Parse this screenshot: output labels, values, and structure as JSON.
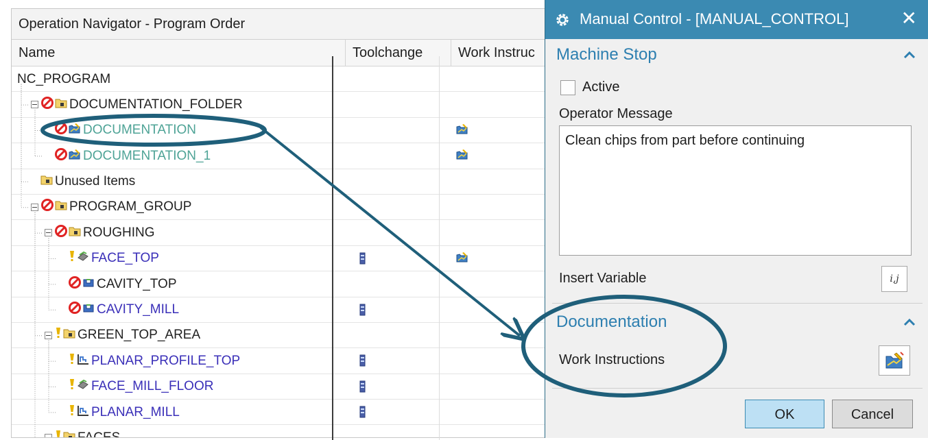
{
  "navigator": {
    "title": "Operation Navigator - Program Order",
    "columns": [
      "Name",
      "Toolchange",
      "Work Instruc"
    ],
    "rows": [
      {
        "name": "NC_PROGRAM",
        "color": "dark",
        "indent": 0,
        "toggle": false,
        "status": "none",
        "icon": "none",
        "tool": false,
        "work": false
      },
      {
        "name": "DOCUMENTATION_FOLDER",
        "color": "dark",
        "indent": 1,
        "toggle": true,
        "status": "prohibited",
        "icon": "folder",
        "tool": false,
        "work": false
      },
      {
        "name": "DOCUMENTATION",
        "color": "teal",
        "indent": 2,
        "toggle": false,
        "status": "prohibited",
        "icon": "doc",
        "tool": false,
        "work": true
      },
      {
        "name": "DOCUMENTATION_1",
        "color": "teal",
        "indent": 2,
        "toggle": false,
        "status": "prohibited",
        "icon": "doc",
        "tool": false,
        "work": true
      },
      {
        "name": "Unused Items",
        "color": "dark",
        "indent": 1,
        "toggle": false,
        "status": "none",
        "icon": "folder",
        "tool": false,
        "work": false
      },
      {
        "name": "PROGRAM_GROUP",
        "color": "dark",
        "indent": 1,
        "toggle": true,
        "status": "prohibited",
        "icon": "folder",
        "tool": false,
        "work": false
      },
      {
        "name": "ROUGHING",
        "color": "dark",
        "indent": 2,
        "toggle": true,
        "status": "prohibited",
        "icon": "folder",
        "tool": false,
        "work": false
      },
      {
        "name": "FACE_TOP",
        "color": "blue",
        "indent": 3,
        "toggle": false,
        "status": "warning",
        "icon": "face",
        "tool": true,
        "work": true
      },
      {
        "name": "CAVITY_TOP",
        "color": "dark",
        "indent": 3,
        "toggle": false,
        "status": "prohibited",
        "icon": "cavity",
        "tool": false,
        "work": false
      },
      {
        "name": "CAVITY_MILL",
        "color": "blue",
        "indent": 3,
        "toggle": false,
        "status": "prohibited",
        "icon": "cavity",
        "tool": true,
        "work": false
      },
      {
        "name": "GREEN_TOP_AREA",
        "color": "dark",
        "indent": 2,
        "toggle": true,
        "status": "warning",
        "icon": "folder",
        "tool": false,
        "work": false
      },
      {
        "name": "PLANAR_PROFILE_TOP",
        "color": "blue",
        "indent": 3,
        "toggle": false,
        "status": "warning",
        "icon": "planar",
        "tool": true,
        "work": false
      },
      {
        "name": "FACE_MILL_FLOOR",
        "color": "blue",
        "indent": 3,
        "toggle": false,
        "status": "warning",
        "icon": "face",
        "tool": true,
        "work": false
      },
      {
        "name": "PLANAR_MILL",
        "color": "blue",
        "indent": 3,
        "toggle": false,
        "status": "warning",
        "icon": "planar",
        "tool": true,
        "work": false
      },
      {
        "name": "FACES",
        "color": "dark",
        "indent": 2,
        "toggle": true,
        "status": "warning",
        "icon": "folder",
        "tool": false,
        "work": false
      }
    ]
  },
  "dialog": {
    "title": "Manual Control - [MANUAL_CONTROL]",
    "close_label": "✕",
    "machine_stop": {
      "heading": "Machine Stop",
      "active_label": "Active",
      "operator_message_label": "Operator Message",
      "operator_message_value": "Clean chips from part  before continuing",
      "insert_variable_label": "Insert Variable",
      "insert_variable_button": "i,j"
    },
    "documentation": {
      "heading": "Documentation",
      "work_instructions_label": "Work Instructions"
    },
    "ok_label": "OK",
    "cancel_label": "Cancel"
  },
  "colors": {
    "accent": "#3b8ab2",
    "annotation": "#1f5f7a",
    "prohibited": "#e02323",
    "warning": "#e8b400",
    "operation_text": "#3a2fb8",
    "documentation_text": "#4ea396"
  }
}
